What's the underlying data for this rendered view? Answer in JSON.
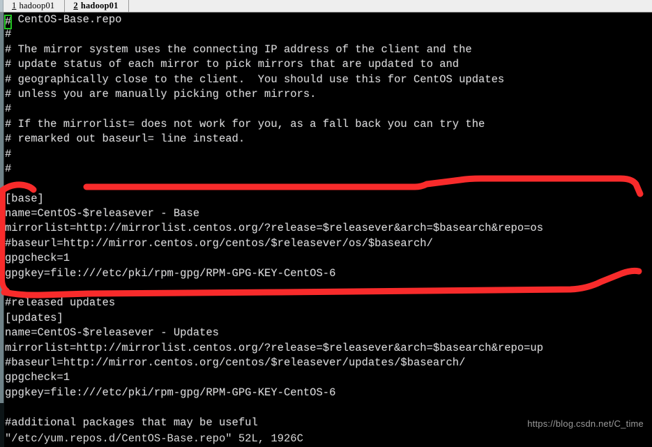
{
  "window": {
    "app": "terminal-emulator",
    "background_color": "#000000"
  },
  "tabbar": {
    "tabs": [
      {
        "index": "1",
        "label": "hadoop01",
        "active": false
      },
      {
        "index": "2",
        "label": "hadoop01",
        "active": true
      }
    ]
  },
  "editor": {
    "program": "vim",
    "filename": "/etc/yum.repos.d/CentOS-Base.repo",
    "cursor_char": "#",
    "cursor_color": "#22c522",
    "lines": [
      {
        "text": "# CentOS-Base.repo",
        "cursor": true
      },
      {
        "text": "#"
      },
      {
        "text": "# The mirror system uses the connecting IP address of the client and the"
      },
      {
        "text": "# update status of each mirror to pick mirrors that are updated to and"
      },
      {
        "text": "# geographically close to the client.  You should use this for CentOS updates"
      },
      {
        "text": "# unless you are manually picking other mirrors."
      },
      {
        "text": "#"
      },
      {
        "text": "# If the mirrorlist= does not work for you, as a fall back you can try the"
      },
      {
        "text": "# remarked out baseurl= line instead."
      },
      {
        "text": "#"
      },
      {
        "text": "#"
      },
      {
        "text": ""
      },
      {
        "text": "[base]"
      },
      {
        "text": "name=CentOS-$releasever - Base"
      },
      {
        "text": "mirrorlist=http://mirrorlist.centos.org/?release=$releasever&arch=$basearch&repo=os"
      },
      {
        "text": "#baseurl=http://mirror.centos.org/centos/$releasever/os/$basearch/"
      },
      {
        "text": "gpgcheck=1"
      },
      {
        "text": "gpgkey=file:///etc/pki/rpm-gpg/RPM-GPG-KEY-CentOS-6"
      },
      {
        "text": ""
      },
      {
        "text": "#released updates"
      },
      {
        "text": "[updates]"
      },
      {
        "text": "name=CentOS-$releasever - Updates"
      },
      {
        "text": "mirrorlist=http://mirrorlist.centos.org/?release=$releasever&arch=$basearch&repo=up"
      },
      {
        "text": "#baseurl=http://mirror.centos.org/centos/$releasever/updates/$basearch/"
      },
      {
        "text": "gpgcheck=1"
      },
      {
        "text": "gpgkey=file:///etc/pki/rpm-gpg/RPM-GPG-KEY-CentOS-6"
      },
      {
        "text": ""
      },
      {
        "text": "#additional packages that may be useful"
      }
    ],
    "status_line": "\"/etc/yum.repos.d/CentOS-Base.repo\" 52L, 1926C"
  },
  "annotation": {
    "color": "#f82b2b",
    "description": "hand-drawn red bracket around [base] repository block"
  },
  "watermark": {
    "text": "https://blog.csdn.net/C_time",
    "color": "#9a9a9a"
  }
}
